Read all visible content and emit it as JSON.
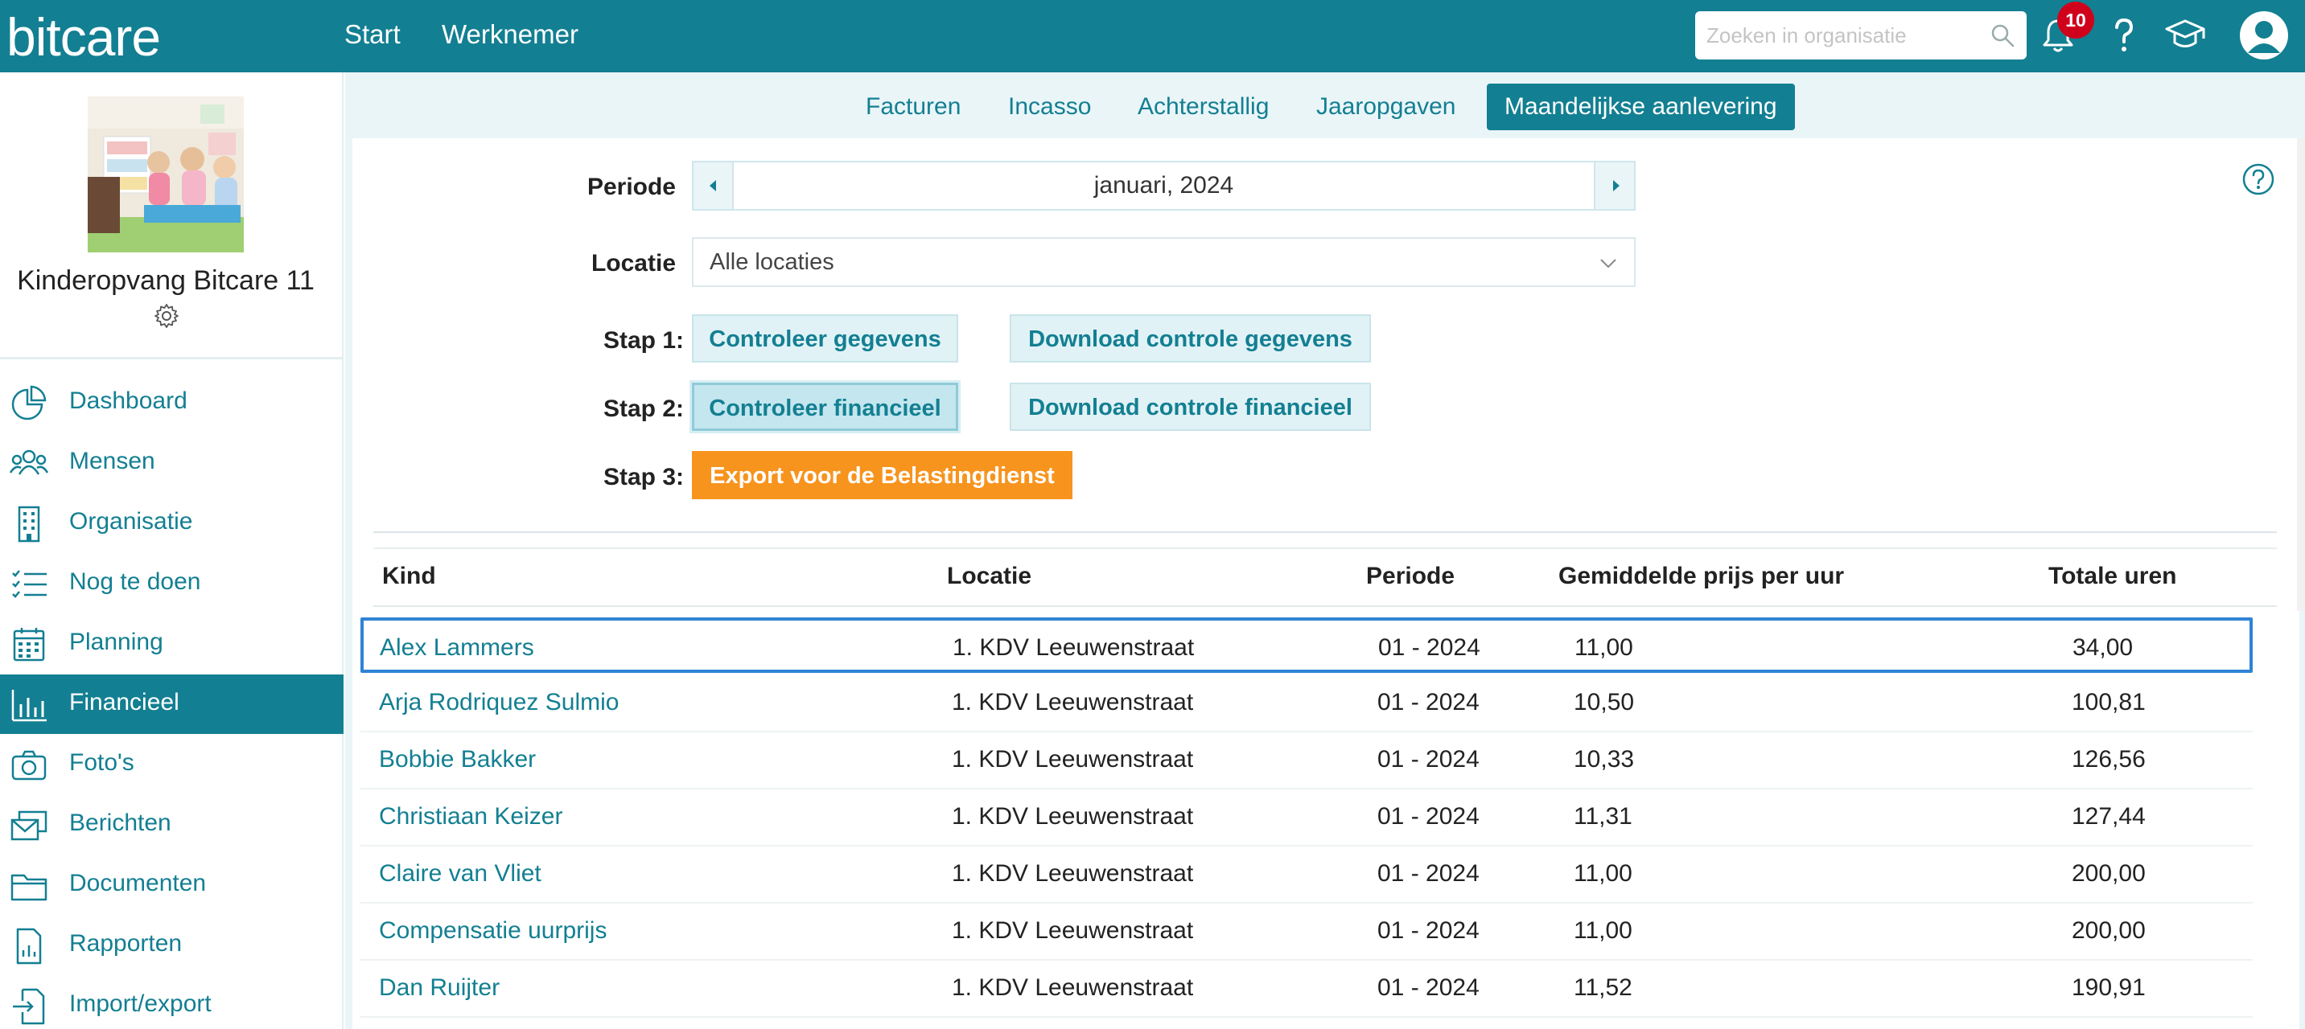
{
  "app": {
    "logo": "bitcare"
  },
  "topnav": {
    "start": "Start",
    "werknemer": "Werknemer"
  },
  "search": {
    "placeholder": "Zoeken in organisatie"
  },
  "notifications": {
    "count": "10"
  },
  "icons": {
    "search": "search-icon",
    "bell": "bell-icon",
    "help": "question-mark-icon",
    "academy": "graduation-cap-icon",
    "user": "user-avatar-icon"
  },
  "colors": {
    "primary": "#137f92",
    "accent": "#f7941e",
    "badge": "#d0021b",
    "selection": "#2f83d6"
  },
  "sidebar": {
    "org_name": "Kinderopvang Bitcare 11",
    "items": [
      {
        "label": "Dashboard",
        "icon": "pie-chart-icon"
      },
      {
        "label": "Mensen",
        "icon": "people-icon"
      },
      {
        "label": "Organisatie",
        "icon": "building-icon"
      },
      {
        "label": "Nog te doen",
        "icon": "checklist-icon"
      },
      {
        "label": "Planning",
        "icon": "calendar-icon"
      },
      {
        "label": "Financieel",
        "icon": "bar-chart-icon",
        "active": true
      },
      {
        "label": "Foto's",
        "icon": "camera-icon"
      },
      {
        "label": "Berichten",
        "icon": "messages-icon"
      },
      {
        "label": "Documenten",
        "icon": "folder-icon"
      },
      {
        "label": "Rapporten",
        "icon": "report-icon"
      },
      {
        "label": "Import/export",
        "icon": "import-export-icon"
      }
    ]
  },
  "tabs": [
    {
      "label": "Facturen"
    },
    {
      "label": "Incasso"
    },
    {
      "label": "Achterstallig"
    },
    {
      "label": "Jaaropgaven"
    },
    {
      "label": "Maandelijkse aanlevering",
      "active": true
    }
  ],
  "form": {
    "periode_label": "Periode",
    "periode_value": "januari, 2024",
    "locatie_label": "Locatie",
    "locatie_value": "Alle locaties"
  },
  "steps": {
    "stap1_label": "Stap 1:",
    "stap2_label": "Stap 2:",
    "stap3_label": "Stap 3:",
    "controleer_gegevens": "Controleer gegevens",
    "download_controle_gegevens": "Download controle gegevens",
    "controleer_financieel": "Controleer financieel",
    "download_controle_financieel": "Download controle financieel",
    "export_belastingdienst": "Export voor de Belastingdienst"
  },
  "table": {
    "headers": {
      "kind": "Kind",
      "locatie": "Locatie",
      "periode": "Periode",
      "prijs": "Gemiddelde prijs per uur",
      "uren": "Totale uren"
    },
    "rows": [
      {
        "kind": "Alex Lammers",
        "locatie": "1. KDV Leeuwenstraat",
        "periode": "01 - 2024",
        "prijs": "11,00",
        "uren": "34,00",
        "selected": true
      },
      {
        "kind": "Arja Rodriquez Sulmio",
        "locatie": "1. KDV Leeuwenstraat",
        "periode": "01 - 2024",
        "prijs": "10,50",
        "uren": "100,81"
      },
      {
        "kind": "Bobbie Bakker",
        "locatie": "1. KDV Leeuwenstraat",
        "periode": "01 - 2024",
        "prijs": "10,33",
        "uren": "126,56"
      },
      {
        "kind": "Christiaan Keizer",
        "locatie": "1. KDV Leeuwenstraat",
        "periode": "01 - 2024",
        "prijs": "11,31",
        "uren": "127,44"
      },
      {
        "kind": "Claire van Vliet",
        "locatie": "1. KDV Leeuwenstraat",
        "periode": "01 - 2024",
        "prijs": "11,00",
        "uren": "200,00"
      },
      {
        "kind": "Compensatie uurprijs",
        "locatie": "1. KDV Leeuwenstraat",
        "periode": "01 - 2024",
        "prijs": "11,00",
        "uren": "200,00"
      },
      {
        "kind": "Dan Ruijter",
        "locatie": "1. KDV Leeuwenstraat",
        "periode": "01 - 2024",
        "prijs": "11,52",
        "uren": "190,91"
      }
    ]
  }
}
